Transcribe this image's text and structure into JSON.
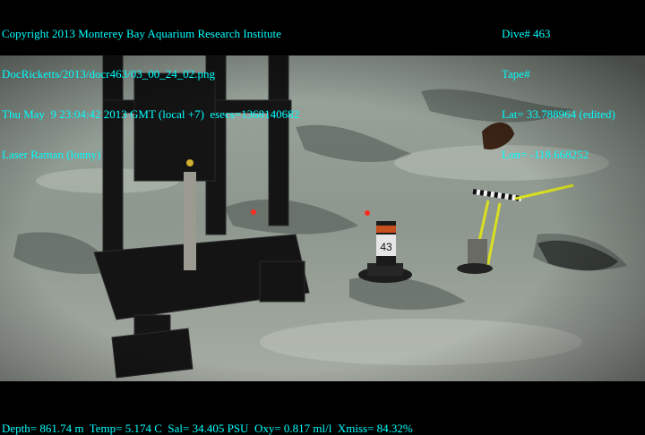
{
  "overlay": {
    "top_left": [
      "Copyright 2013 Monterey Bay Aquarium Research Institute",
      "DocRicketts/2013/docr463/03_00_24_02.png",
      "Thu May  9 23:04:42 2013 GMT (local +7)  esecs=1368140682",
      "Laser Raman (lonny)"
    ],
    "top_right": [
      "Dive# 463",
      "Tape#",
      "Lat= 33.788964 (edited)",
      "Lon= -118.668252"
    ],
    "bottom": "Depth= 861.74 m  Temp= 5.174 C  Sal= 34.405 PSU  Oxy= 0.817 ml/l  Xmiss= 84.32%"
  },
  "scene": {
    "marker_label": "43",
    "colors": {
      "overlay_text": "#00ffff",
      "seafloor": "#8f988f",
      "frame": "#141414",
      "laser": "#ff2a20",
      "rope": "#d8e020"
    }
  }
}
